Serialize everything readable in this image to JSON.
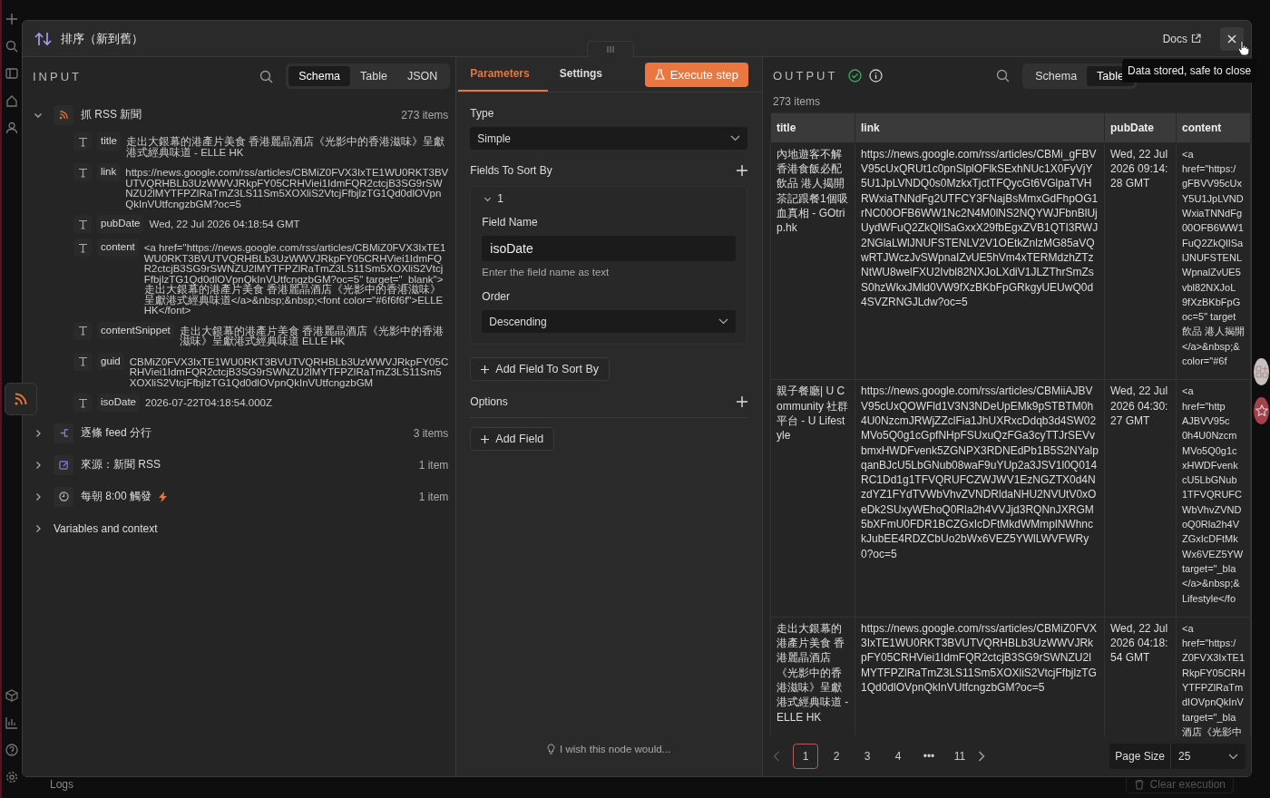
{
  "modal": {
    "title": "排序（新到舊）",
    "docs_link": "Docs",
    "input": {
      "heading": "INPUT",
      "view_tabs": [
        {
          "label": "Schema",
          "selected": true
        },
        {
          "label": "Table",
          "selected": false
        },
        {
          "label": "JSON",
          "selected": false
        }
      ],
      "nodes": [
        {
          "kind": "rss",
          "name": "抓 RSS 新聞",
          "count": "273 items",
          "expanded": true,
          "trigger": false,
          "fields": [
            {
              "name": "title",
              "value": "走出大銀幕的港產片美食 香港麗晶酒店《光影中的香港滋味》呈獻港式經典味道 - ELLE HK"
            },
            {
              "name": "link",
              "value": "https://news.google.com/rss/articles/CBMiZ0FVX3IxTE1WU0RKT3BVUTVQRHBLb3UzWWVJRkpFY05CRHViei1IdmFQR2ctcjB3SG9rSWNZU2lMYTFPZlRaTmZ3LS11Sm5XOXliS2VtcjFfbjlzTG1Qd0dlOVpnQkInVUtfcngzbGM?oc=5"
            },
            {
              "name": "pubDate",
              "value": "Wed, 22 Jul 2026 04:18:54 GMT"
            },
            {
              "name": "content",
              "value": "<a href=\"https://news.google.com/rss/articles/CBMiZ0FVX3IxTE1WU0RKT3BVUTVQRHBLb3UzWWVJRkpFY05CRHViei1IdmFQR2ctcjB3SG9rSWNZU2lMYTFPZlRaTmZ3LS11Sm5XOXliS2VtcjFfbjlzTG1Qd0dlOVpnQkInVUtfcngzbGM?oc=5\" target=\"_blank\">走出大銀幕的港產片美食 香港麗晶酒店《光影中的香港滋味》呈獻港式經典味道</a>&nbsp;&nbsp;<font color=\"#6f6f6f\">ELLE HK</font>"
            },
            {
              "name": "contentSnippet",
              "value": "走出大銀幕的港產片美食 香港麗晶酒店《光影中的香港滋味》呈獻港式經典味道  ELLE HK"
            },
            {
              "name": "guid",
              "value": "CBMiZ0FVX3IxTE1WU0RKT3BVUTVQRHBLb3UzWWVJRkpFY05CRHViei1IdmFQR2ctcjB3SG9rSWNZU2lMYTFPZlRaTmZ3LS11Sm5XOXliS2VtcjFfbjlzTG1Qd0dlOVpnQkInVUtfcngzbGM"
            },
            {
              "name": "isoDate",
              "value": "2026-07-22T04:18:54.000Z"
            }
          ]
        },
        {
          "kind": "split",
          "name": "逐條 feed 分行",
          "count": "3 items",
          "expanded": false,
          "trigger": false
        },
        {
          "kind": "edit",
          "name": "來源：新聞 RSS",
          "count": "1 item",
          "expanded": false,
          "trigger": false
        },
        {
          "kind": "schedule",
          "name": "每朝 8:00 觸發",
          "count": "1 item",
          "expanded": false,
          "trigger": true
        }
      ],
      "variables": {
        "label": "Variables and context",
        "expanded": false
      }
    },
    "parameters": {
      "tabs": [
        {
          "label": "Parameters",
          "selected": true
        },
        {
          "label": "Settings",
          "selected": false
        }
      ],
      "execute_button": "Execute step",
      "type_label": "Type",
      "type_value": "Simple",
      "fields_label": "Fields To Sort By",
      "sort_fields": [
        {
          "index": "1",
          "expanded": true,
          "field_name_label": "Field Name",
          "field_name": "isoDate",
          "hint": "Enter the field name as text",
          "order_label": "Order",
          "order": "Descending"
        }
      ],
      "add_sort_button": "Add Field To Sort By",
      "options_label": "Options",
      "add_field_button": "Add Field",
      "feedback": "I wish this node would..."
    },
    "output": {
      "heading": "OUTPUT",
      "success": true,
      "view_tabs": [
        {
          "label": "Schema",
          "selected": false
        },
        {
          "label": "Table",
          "selected": true
        }
      ],
      "tooltip": "Data stored, safe to close",
      "count": "273 items",
      "table": {
        "columns": [
          "title",
          "link",
          "pubDate",
          "content"
        ],
        "rows": [
          [
            "內地遊客不解香港食飯必配飲品 港人揭開茶記跟餐1個吸血真相 - GOtrip.hk",
            "https://news.google.com/rss/articles/CBMi_gFBVV95cUxQRUt1c0pnSlplOFlkSExhNUc1X0FyVjY5U1JpLVNDQ0s0MzkxTjctTFQycGt6VGlpaTVHRWxiaTNNdFg2UTFCY3FNajBsMmxGdFhpOG1rNC00OFB6WW1Nc2N4M0lNS2NQYWJFbnBlUjUydWFuQ2ZkQllSaGxxX29fbEgxZVB1QTI3RWJ2NGlaLWlJNUFSTENLV2V1OEtkZnlzMG85aVQwRTJWczJvSWpnaIZvUE5hVm4xTERMdzhZTzNtWU8welFXU2Ivbl82NXJoLXdiV1JLZThrSmZsS0hzWkxJMld0VW9fXzBKbFpGRkgyUEUwQ0d4SVZRNGJLdw?oc=5",
            "Wed, 22 Jul 2026 09:14:28 GMT",
            "<a\nhref=\"https:/\ngFBVV95cUx\nY5U1JpLVND\nWxiaTNNdFg\n00OFB6WW1\nFuQ2ZkQlISa\nlJNUFSTENL\nWpnalZvUE5\nvbl82NXJoL\n9fXzBKbFpG\noc=5\" target\n飲品 港人揭開\n</a>&nbsp;&\ncolor=\"#6f"
          ],
          [
            "親子餐廳| U Community 社群平台 - U Lifestyle",
            "https://news.google.com/rss/articles/CBMiiAJBVV95cUxQOWFld1V3N3NDeUpEMk9pSTBTM0h4U0NzcmJRWjZZclFia1JhUXRxcDdqb3d4SW02MVo5Q0g1cGpfNHpFSUxuQzFGa3cyTTJrSEVvbmxHWDFvenk5ZGNPX3RDNEdPb1B5S2NYalpqanBJcU5LbGNub08waF9uYUp2a3JSV1l0Q014RC1Dd1g1TFVQRUFCZWJWV1EzNGZTX0d4NzdYZ1FYdTVWbVhvZVNDRldaNHU2NVUtV0xOeDk2SUxyWEhoQ0Rla2h4VVJjd3RQNnJXRGM5bXFmU0FDR1BCZGxIcDFtMkdWMmplNWhnckJubEE4RDZCbUo2bWx6VEZ5YWlLWVFWRy0?oc=5",
            "Wed, 22 Jul 2026 04:30:27 GMT",
            "<a\nhref=\"http\nAJBVV95c\n0h4U0Nzcm\nMVo5Q0g1c\nxHWDFvenk\ncU5LbGNub\n1TFVQRUFC\nWbVhvZVND\noQ0Rla2h4V\nZGxIcDFtMk\nWx6VEZ5YW\ntarget=\"_bla\n</a>&nbsp;&\nLifestyle</fo"
          ],
          [
            "走出大銀幕的港產片美食 香港麗晶酒店《光影中的香港滋味》呈獻港式經典味道 - ELLE HK",
            "https://news.google.com/rss/articles/CBMiZ0FVX3IxTE1WU0RKT3BVUTVQRHBLb3UzWWVJRkpFY05CRHViei1IdmFQR2ctcjB3SG9rSWNZU2lMYTFPZlRaTmZ3LS11Sm5XOXliS2VtcjFfbjlzTG1Qd0dlOVpnQkInVUtfcngzbGM?oc=5",
            "Wed, 22 Jul 2026 04:18:54 GMT",
            "<a\nhref=\"https:/\nZ0FVX3IxTE1\nRkpFY05CRH\nYTFPZlRaTm\ndIOVpnQkInV\ntarget=\"_bla\n酒店《光影中"
          ]
        ]
      },
      "pagination": {
        "pages": [
          {
            "label": "1",
            "selected": true
          },
          {
            "label": "2",
            "selected": false
          },
          {
            "label": "3",
            "selected": false
          },
          {
            "label": "4",
            "selected": false
          },
          {
            "label": "•••",
            "selected": false
          },
          {
            "label": "11",
            "selected": false
          }
        ],
        "page_size_label": "Page Size",
        "page_size": "25"
      }
    }
  },
  "bottom_bar": {
    "logs": "Logs",
    "clear_button": "Clear execution"
  }
}
